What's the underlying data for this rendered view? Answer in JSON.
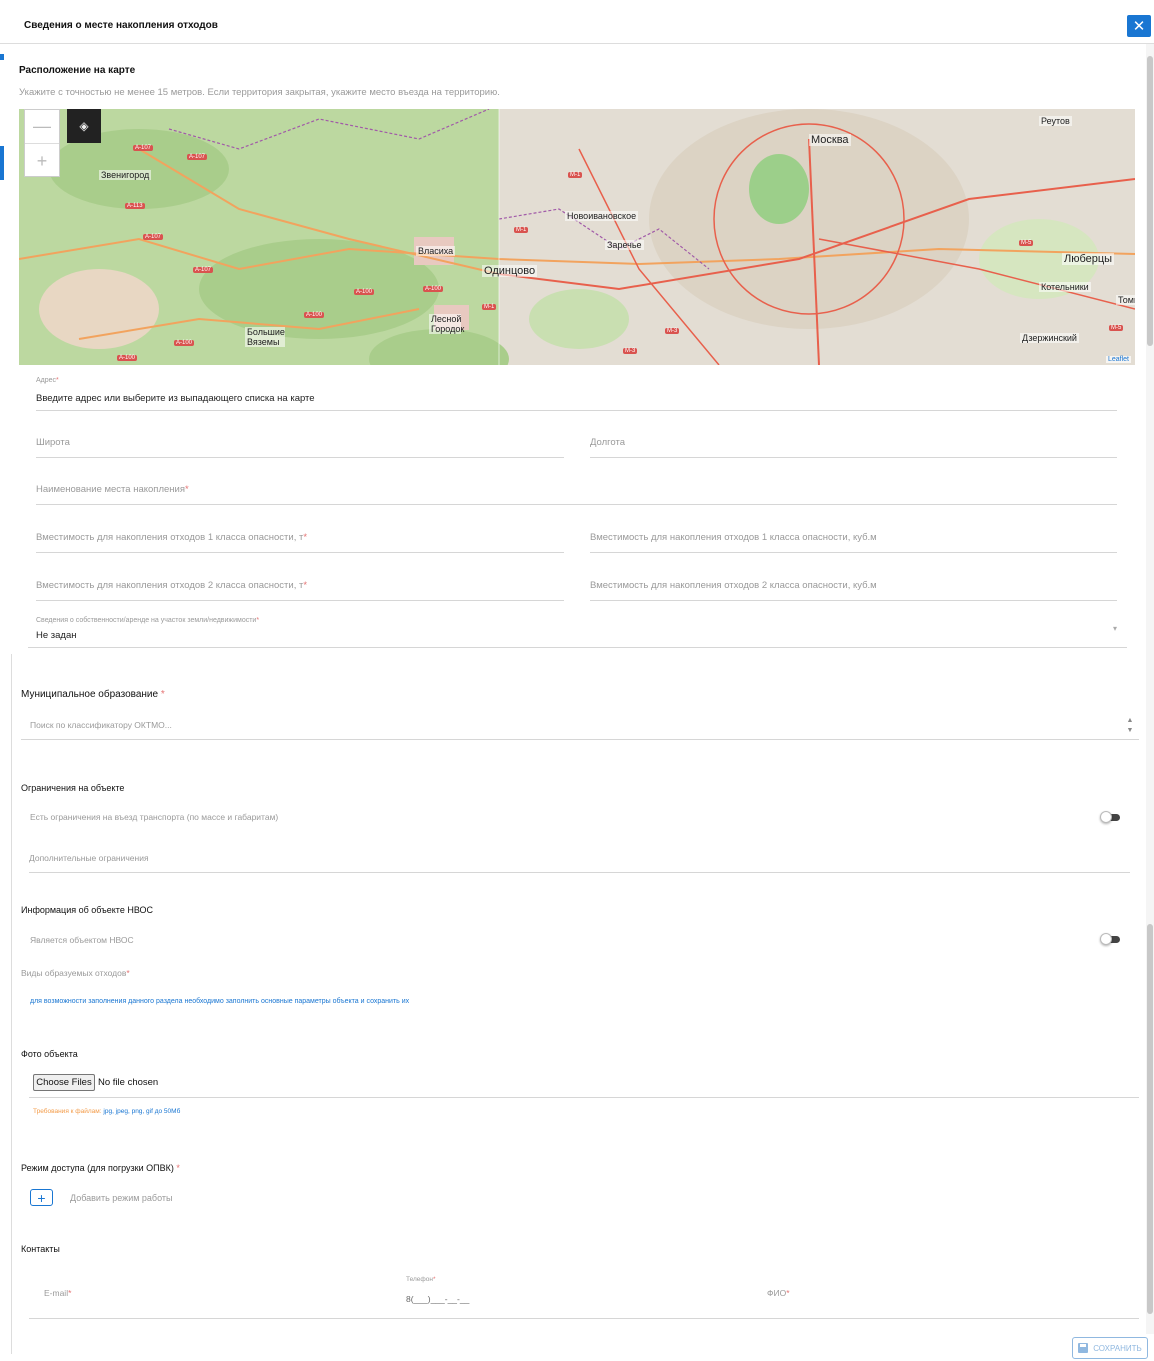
{
  "header": {
    "title": "Сведения о месте накопления отходов",
    "close_icon": "close-icon"
  },
  "location": {
    "title": "Расположение на карте",
    "hint": "Укажите с точностью не менее 15 метров. Если территория закрытая, укажите место въезда на территорию."
  },
  "map": {
    "zoom_in": "+",
    "zoom_out": "—",
    "layers_icon": "layers-icon",
    "attribution": "Leaflet",
    "places": [
      "Москва",
      "Одинцово",
      "Звенигород",
      "Власиха",
      "Люберцы",
      "Котельники",
      "Дзержинский",
      "Реутов",
      "Новоивановское",
      "Заречье",
      "Большие Вяземы",
      "Лесной Городок",
      "Томи"
    ],
    "roads": [
      "A-107",
      "A-107",
      "A-113",
      "A-107",
      "A-107",
      "A-100",
      "A-100",
      "A-100",
      "A-100",
      "A-100",
      "M-1",
      "M-1",
      "M-1",
      "M-3",
      "M-3",
      "M-5",
      "M-5"
    ]
  },
  "fields": {
    "address": {
      "label": "Адрес",
      "value": "Введите адрес или выберите из выпадающего списка на карте"
    },
    "latitude": {
      "placeholder": "Широта"
    },
    "longitude": {
      "placeholder": "Долгота"
    },
    "site_name": {
      "placeholder": "Наименование места накопления"
    },
    "capacity1_t": {
      "placeholder": "Вместимость для накопления отходов 1 класса опасности, т"
    },
    "capacity1_m3": {
      "placeholder": "Вместимость для накопления отходов 1 класса опасности, куб.м"
    },
    "capacity2_t": {
      "placeholder": "Вместимость для накопления отходов 2 класса опасности, т"
    },
    "capacity2_m3": {
      "placeholder": "Вместимость для накопления отходов 2 класса опасности, куб.м"
    },
    "ownership": {
      "label": "Сведения о собственности/аренде на участок земли/недвижимости",
      "value": "Не задан"
    }
  },
  "municipality": {
    "title": "Муниципальное образование",
    "placeholder": "Поиск по классификатору ОКТМО..."
  },
  "restrictions": {
    "title": "Ограничения на объекте",
    "transport_label": "Есть ограничения на въезд транспорта (по массе и габаритам)",
    "transport_on": false,
    "additional_placeholder": "Дополнительные ограничения"
  },
  "nvos": {
    "title": "Информация об объекте НВОС",
    "is_nvos_label": "Является объектом НВОС",
    "is_nvos_on": false,
    "waste_types_label": "Виды образуемых отходов",
    "waste_types_info": "для возможности заполнения данного раздела необходимо заполнить основные параметры объекта и сохранить их"
  },
  "photo": {
    "title": "Фото объекта",
    "choose_button": "Choose Files",
    "no_file": "No file chosen",
    "req_prefix": "Требования к файлам:",
    "req_formats": "jpg, jpeg, png, gif до 50Мб"
  },
  "access": {
    "title": "Режим доступа (для погрузки ОПВК)",
    "add_label": "Добавить режим работы"
  },
  "contacts": {
    "title": "Контакты",
    "email_placeholder": "E-mail",
    "phone_label": "Телефон",
    "phone_mask": "8(___)___-__-__",
    "fio_placeholder": "ФИО"
  },
  "footer": {
    "save_label": "СОХРАНИТЬ",
    "save_icon": "floppy-disk-icon"
  },
  "colors": {
    "accent": "#1976d2",
    "required": "#e57373",
    "hint": "#9a9a9a"
  }
}
